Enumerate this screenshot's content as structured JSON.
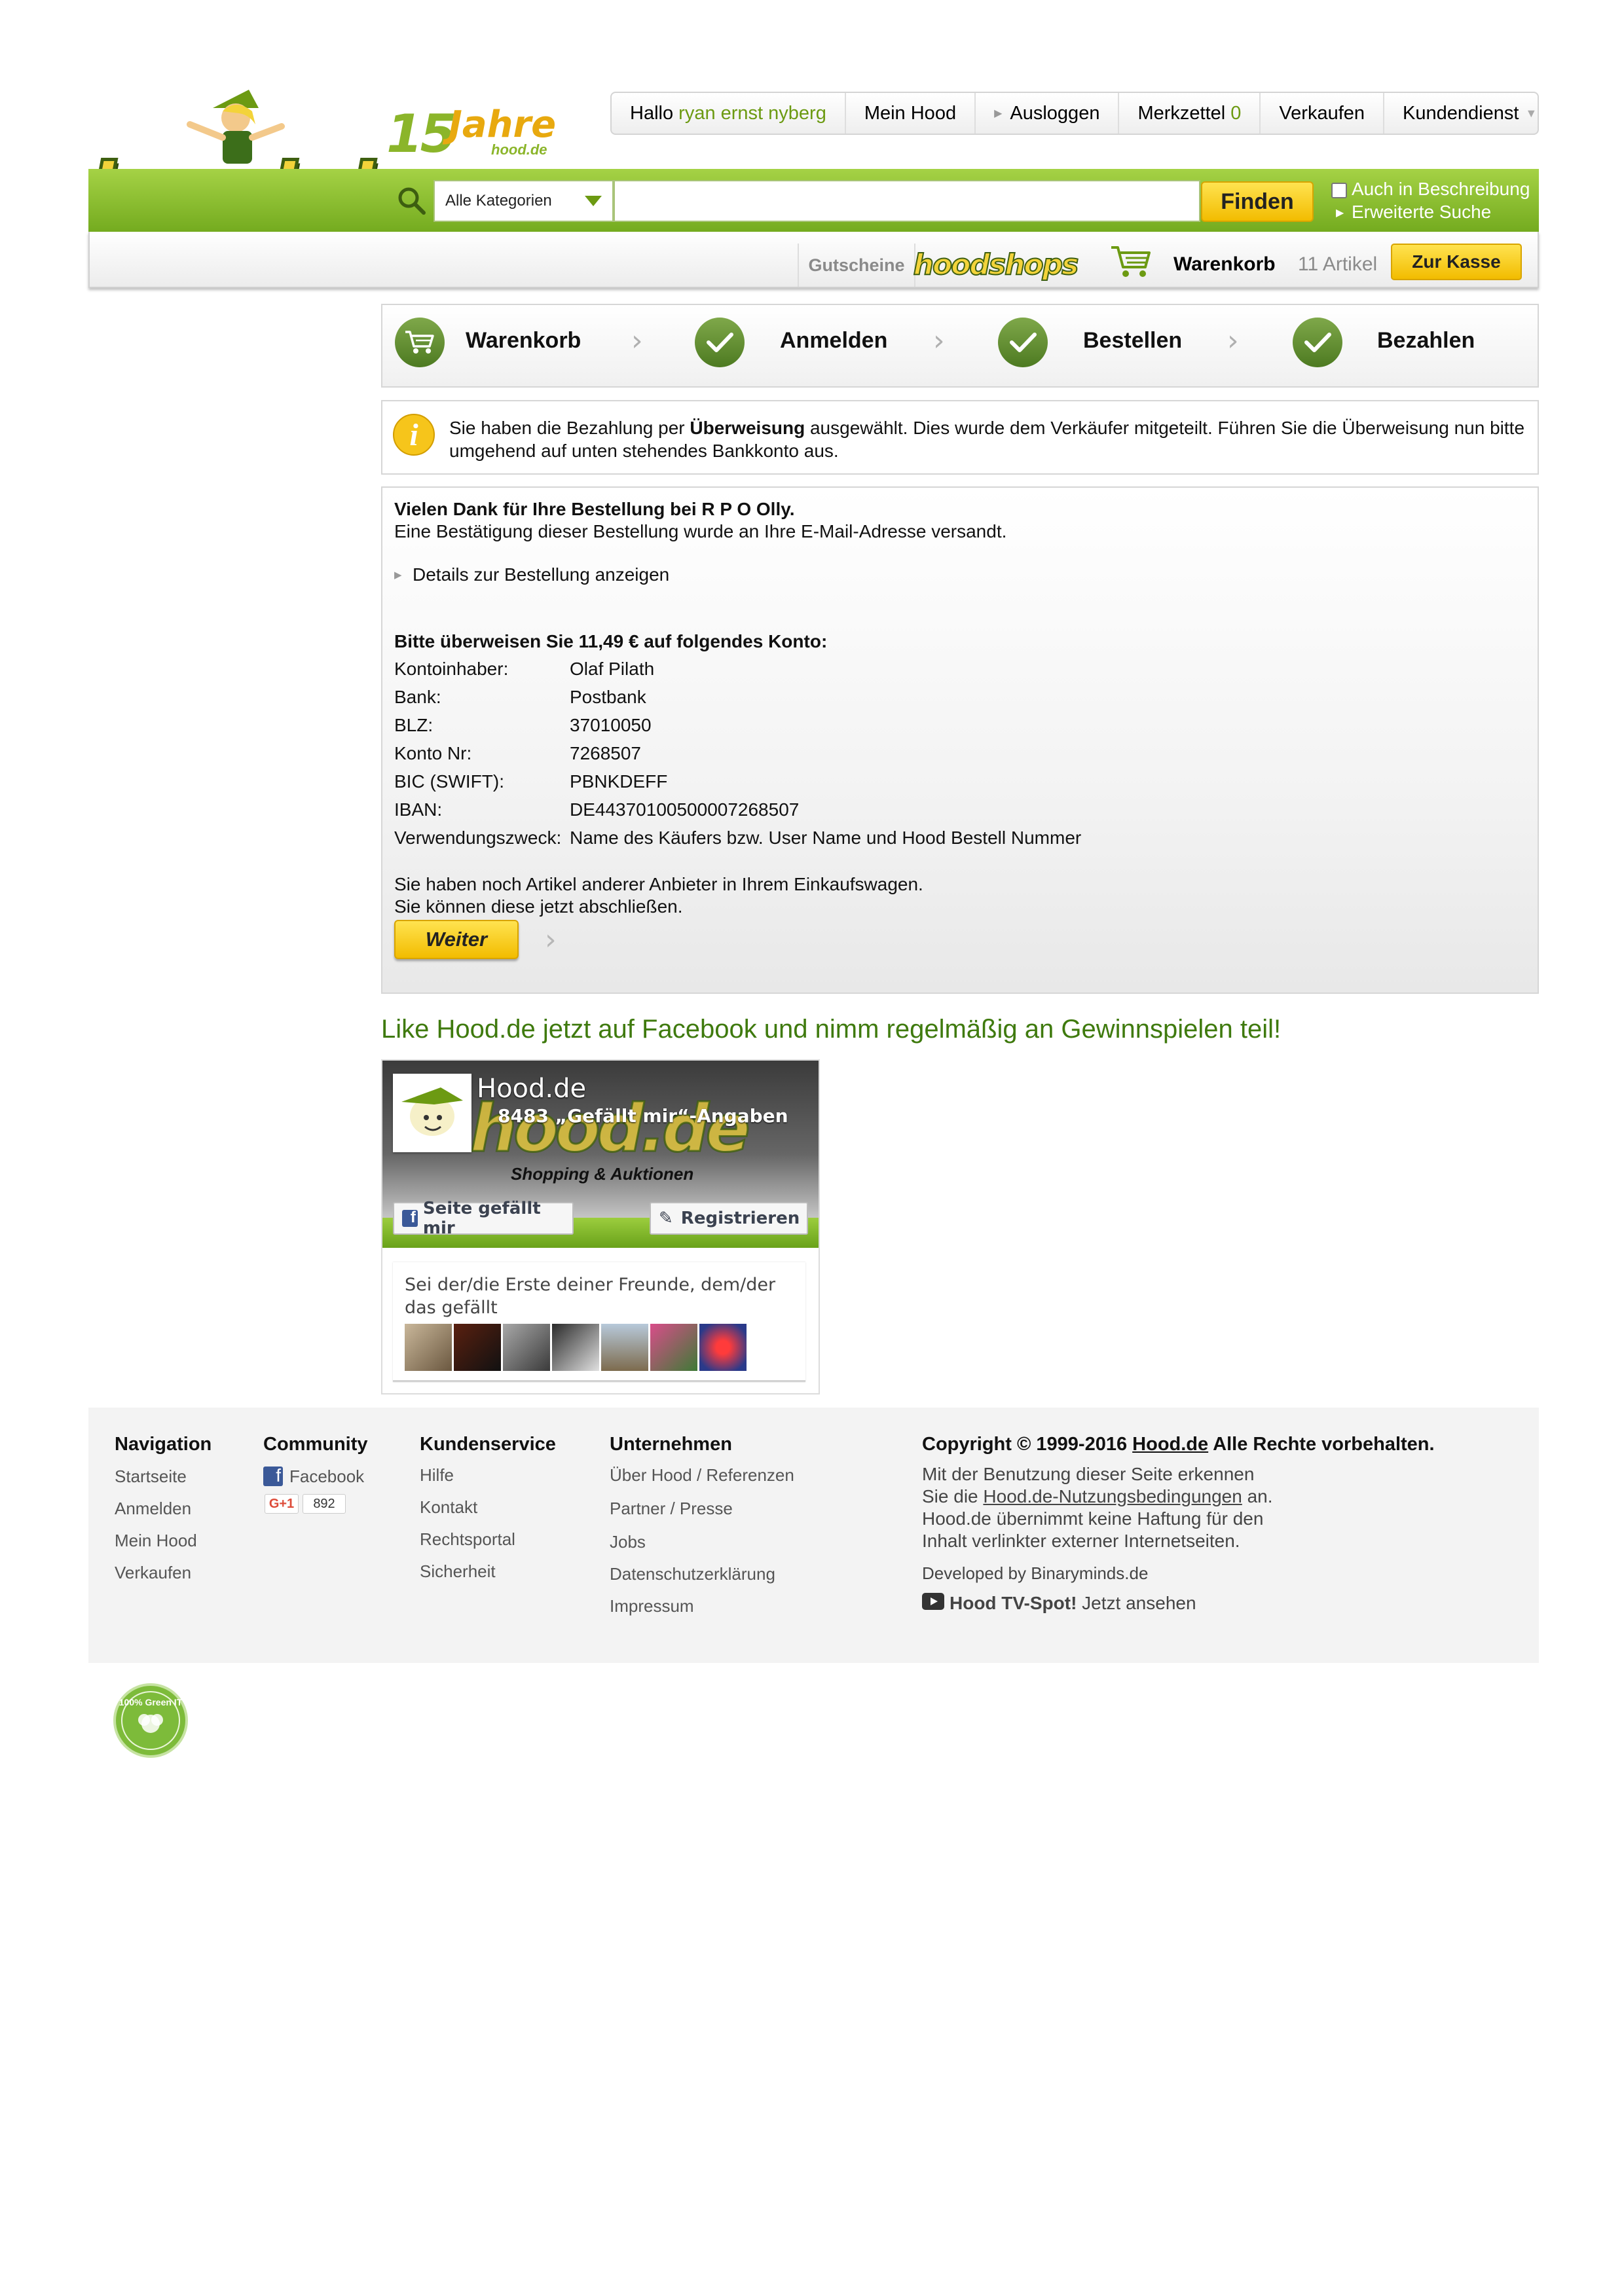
{
  "brand": {
    "logo_text": "hood.de",
    "anniversary_number": "15",
    "anniversary_word": "Jahre",
    "anniversary_sub": "hood.de"
  },
  "topnav": {
    "greeting": "Hallo ",
    "user": "ryan ernst nyberg",
    "my_hood": "Mein Hood",
    "logout": "Ausloggen",
    "wishlist": "Merkzettel ",
    "wishlist_count": "0",
    "sell": "Verkaufen",
    "customer_service": "Kundendienst"
  },
  "search": {
    "category": "Alle Kategorien",
    "query": "",
    "button": "Finden",
    "also_description": "Auch in Beschreibung",
    "advanced": "Erweiterte Suche"
  },
  "subnav": {
    "vouchers": "Gutscheine",
    "shops": "hoodshops",
    "cart_label": "Warenkorb",
    "cart_count": "11 Artikel",
    "checkout": "Zur Kasse"
  },
  "steps": [
    {
      "label": "Warenkorb",
      "icon": "cart-icon"
    },
    {
      "label": "Anmelden",
      "icon": "check-icon"
    },
    {
      "label": "Bestellen",
      "icon": "check-icon"
    },
    {
      "label": "Bezahlen",
      "icon": "check-icon"
    }
  ],
  "info": {
    "prefix": "Sie haben die Bezahlung per ",
    "method": "Überweisung",
    "suffix": " ausgewählt. Dies wurde dem Verkäufer mitgeteilt. Führen Sie die Überweisung nun bitte umgehend auf unten stehendes Bankkonto aus."
  },
  "order": {
    "thanks": "Vielen Dank für Ihre Bestellung bei R P O Olly.",
    "confirmation": "Eine Bestätigung dieser Bestellung wurde an Ihre E-Mail-Adresse versandt.",
    "details_link": "Details zur Bestellung anzeigen",
    "transfer_heading": "Bitte überweisen Sie 11,49 € auf folgendes Konto:",
    "bank_details": [
      {
        "label": "Kontoinhaber:",
        "value": "Olaf Pilath"
      },
      {
        "label": "Bank:",
        "value": "Postbank"
      },
      {
        "label": "BLZ:",
        "value": "37010050"
      },
      {
        "label": "Konto Nr:",
        "value": "7268507"
      },
      {
        "label": "BIC (SWIFT):",
        "value": "PBNKDEFF"
      },
      {
        "label": "IBAN:",
        "value": "DE44370100500007268507"
      },
      {
        "label": "Verwendungszweck:",
        "value": "Name des Käufers bzw. User Name und Hood Bestell Nummer"
      }
    ],
    "other_items_1": "Sie haben noch Artikel anderer Anbieter in Ihrem Einkaufswagen.",
    "other_items_2": "Sie können diese jetzt abschließen.",
    "continue": "Weiter"
  },
  "facebook": {
    "headline": "Like Hood.de jetzt auf Facebook und nimm regelmäßig an Gewinnspielen teil!",
    "page_name": "Hood.de",
    "likes": "8483 „Gefällt mir“-Angaben",
    "cover_logo": "hood.de",
    "tagline": "Shopping & Auktionen",
    "like_button": "Seite gefällt mir",
    "register_button": "Registrieren",
    "friends_text": "Sei der/die Erste deiner Freunde, dem/der das gefällt"
  },
  "footer": {
    "navigation": {
      "title": "Navigation",
      "links": [
        "Startseite",
        "Anmelden",
        "Mein Hood",
        "Verkaufen"
      ]
    },
    "community": {
      "title": "Community",
      "facebook": "Facebook",
      "gplus": "G+1",
      "gplus_count": "892"
    },
    "service": {
      "title": "Kundenservice",
      "links": [
        "Hilfe",
        "Kontakt",
        "Rechtsportal",
        "Sicherheit"
      ]
    },
    "company": {
      "title": "Unternehmen",
      "links": [
        "Über Hood / Referenzen",
        "Partner / Presse",
        "Jobs",
        "Datenschutzerklärung",
        "Impressum"
      ]
    },
    "copyright_prefix": "Copyright © 1999-2016 ",
    "copyright_link": "Hood.de",
    "copyright_suffix": " Alle Rechte vorbehalten.",
    "terms_1": "Mit der Benutzung dieser Seite erkennen",
    "terms_2_prefix": "Sie die ",
    "terms_2_link": "Hood.de-Nutzungsbedingungen",
    "terms_2_suffix": " an.",
    "terms_3": "Hood.de übernimmt keine Haftung für den",
    "terms_4": "Inhalt verlinkter externer Internetseiten.",
    "developer": "Developed by Binaryminds.de",
    "tv_spot": "Hood TV-Spot!",
    "tv_suffix": " Jetzt ansehen"
  },
  "badge": {
    "text": "100% Green IT"
  },
  "colors": {
    "brand_green": "#74ab1f",
    "brand_yellow": "#f2bc00",
    "headline_green": "#3f7a0e",
    "facebook_blue": "#3b5998"
  }
}
